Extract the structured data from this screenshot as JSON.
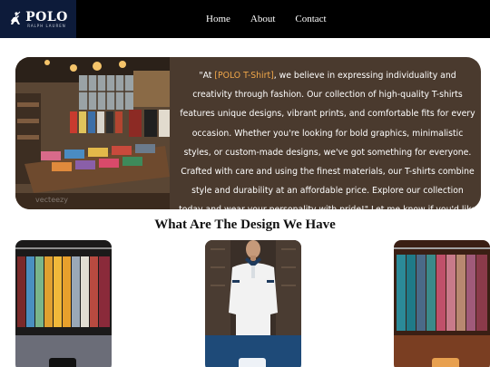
{
  "brand": {
    "name": "POLO",
    "tagline": "RALPH LAUREN",
    "colors": {
      "navbar": "#000000",
      "logo_bg": "#0d1b3a",
      "hero_bg": "#4a3a2e",
      "brand_accent": "#f0a74a"
    }
  },
  "nav": {
    "items": [
      {
        "label": "Home"
      },
      {
        "label": "About"
      },
      {
        "label": "Contact"
      }
    ]
  },
  "hero": {
    "text_prefix": "\"At ",
    "brand_mention": "[POLO T-Shirt]",
    "text_body": ", we believe in expressing individuality and creativity through fashion. Our collection of high-quality T-shirts features unique designs, vibrant prints, and comfortable fits for every occasion. Whether you're looking for bold graphics, minimalistic styles, or custom-made designs, we've got something for everyone. Crafted with care and using the finest materials, our T-shirts combine style and durability at an affordable price. Explore our collection today and wear your personality with pride!\" Let me know if you'd like to tweak this or add a specific",
    "photo_watermark": "vecteezy"
  },
  "designs": {
    "title": "What Are The Design We Have",
    "cards": [
      {
        "name": "card-1",
        "footer_color": "#6b6d78",
        "button_color": "#111111"
      },
      {
        "name": "card-2",
        "footer_color": "#1e4a78",
        "button_color": "#eef2f7"
      },
      {
        "name": "card-3",
        "footer_color": "#7a3e22",
        "button_color": "#e8a04f"
      }
    ]
  }
}
